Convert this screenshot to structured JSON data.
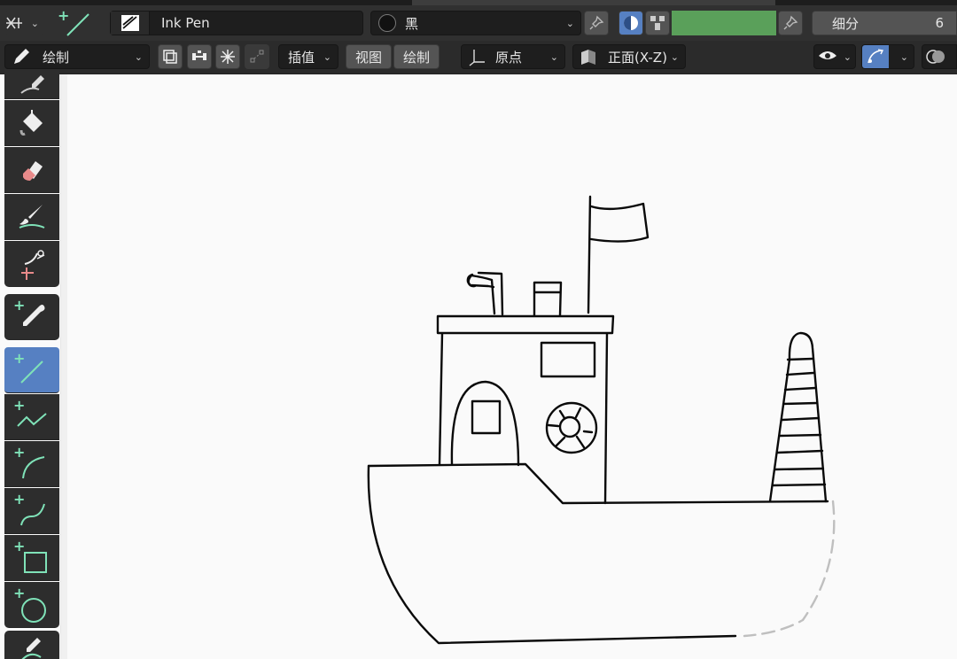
{
  "header": {
    "brush_name": "Ink Pen",
    "material_name": "黑",
    "subdivision_label": "细分",
    "subdivision_value": "6",
    "color_swatch": "#5aa05a"
  },
  "toolbar": {
    "mode_label": "绘制",
    "interpolate_label": "插值",
    "view_label": "视图",
    "draw_label": "绘制",
    "origin_label": "原点",
    "plane_label": "正面(X-Z)"
  },
  "sidebar": {
    "tools": [
      {
        "name": "draw-tool",
        "icon": "pencil-icon"
      },
      {
        "name": "fill-tool",
        "icon": "bucket-icon"
      },
      {
        "name": "erase-tool",
        "icon": "eraser-icon"
      },
      {
        "name": "tint-tool",
        "icon": "brush-icon"
      },
      {
        "name": "cutter-tool",
        "icon": "scissors-icon"
      },
      {
        "name": "eyedropper-tool",
        "icon": "eyedropper-icon"
      },
      {
        "name": "line-tool",
        "icon": "line-icon"
      },
      {
        "name": "polyline-tool",
        "icon": "polyline-icon"
      },
      {
        "name": "arc-tool",
        "icon": "arc-icon"
      },
      {
        "name": "curve-tool",
        "icon": "curve-icon"
      },
      {
        "name": "box-tool",
        "icon": "box-icon"
      },
      {
        "name": "circle-tool",
        "icon": "circle-icon"
      },
      {
        "name": "annotate-tool",
        "icon": "annotate-icon"
      }
    ]
  },
  "colors": {
    "accent": "#5680c2",
    "tool_plus": "#7fe2b8"
  }
}
